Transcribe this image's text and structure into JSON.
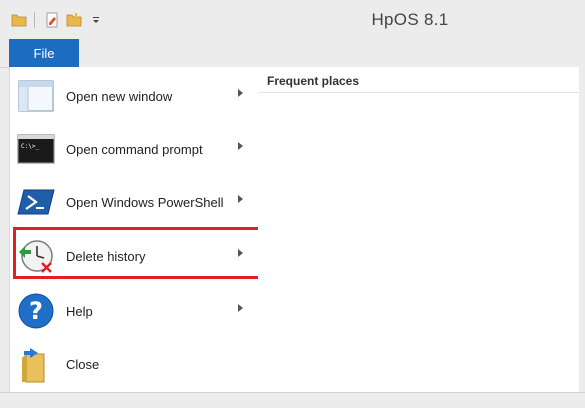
{
  "window": {
    "title": "HpOS 8.1"
  },
  "quick_access": {
    "icons": [
      "folder-icon",
      "properties-icon",
      "new-folder-icon",
      "customize-dropdown-icon"
    ]
  },
  "ribbon": {
    "file_tab": "File"
  },
  "file_menu": {
    "items": [
      {
        "label": "Open new window",
        "icon": "window-icon",
        "has_submenu": true
      },
      {
        "label": "Open command prompt",
        "icon": "command-prompt-icon",
        "has_submenu": true
      },
      {
        "label": "Open Windows PowerShell",
        "icon": "powershell-icon",
        "has_submenu": true
      },
      {
        "label": "Delete history",
        "icon": "delete-history-icon",
        "has_submenu": true,
        "highlighted": true
      },
      {
        "label": "Help",
        "icon": "help-icon",
        "has_submenu": true
      },
      {
        "label": "Close",
        "icon": "close-folder-icon",
        "has_submenu": false
      }
    ]
  },
  "frequent_places": {
    "title": "Frequent places"
  },
  "colors": {
    "file_tab": "#1c6cc1",
    "highlight_border": "#e31e24"
  }
}
